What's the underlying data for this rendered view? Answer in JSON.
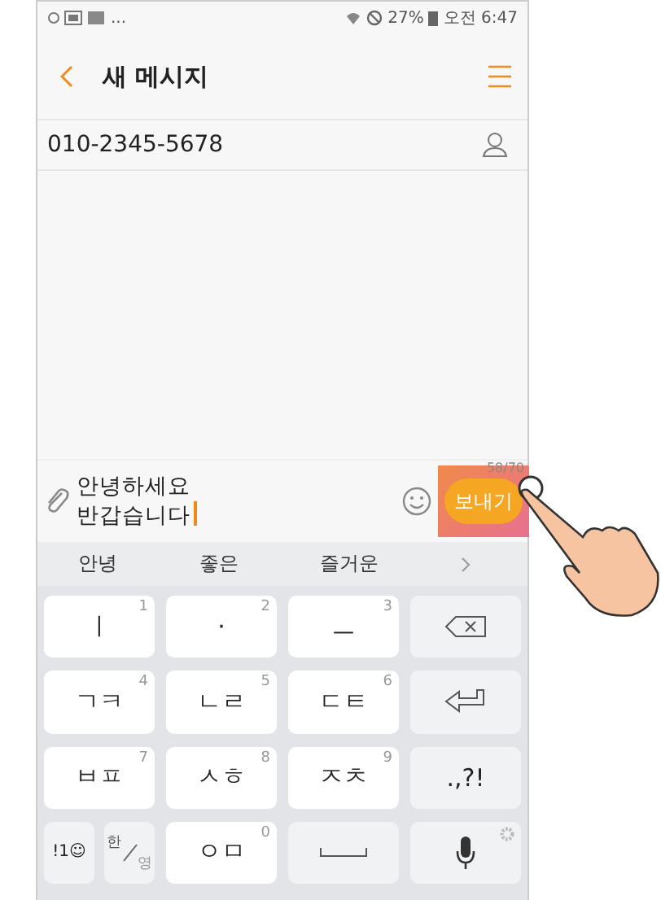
{
  "status_bar": {
    "overflow": "...",
    "battery": "27%",
    "time": "오전 6:47"
  },
  "header": {
    "title": "새 메시지"
  },
  "recipient": {
    "value": "010-2345-5678"
  },
  "composer": {
    "lines": [
      "안녕하세요",
      "반갑습니다"
    ],
    "counter": "58/70",
    "send": "보내기"
  },
  "suggestions": [
    "안녕",
    "좋은",
    "즐거운"
  ],
  "keyboard": [
    [
      {
        "kind": "char",
        "label": "ㅣ",
        "digit": "1"
      },
      {
        "kind": "char",
        "label": "·",
        "digit": "2"
      },
      {
        "kind": "char",
        "label": "ㅡ",
        "digit": "3"
      },
      {
        "kind": "backspace"
      }
    ],
    [
      {
        "kind": "char",
        "label": "ㄱㅋ",
        "digit": "4"
      },
      {
        "kind": "char",
        "label": "ㄴㄹ",
        "digit": "5"
      },
      {
        "kind": "char",
        "label": "ㄷㅌ",
        "digit": "6"
      },
      {
        "kind": "enter"
      }
    ],
    [
      {
        "kind": "char",
        "label": "ㅂㅍ",
        "digit": "7"
      },
      {
        "kind": "char",
        "label": "ㅅㅎ",
        "digit": "8"
      },
      {
        "kind": "char",
        "label": "ㅈㅊ",
        "digit": "9"
      },
      {
        "kind": "fn",
        "label": ".,?!"
      }
    ],
    [
      {
        "kind": "split",
        "symbols": "!1☺",
        "top": "한",
        "bottom": "영"
      },
      {
        "kind": "char",
        "label": "ㅇㅁ",
        "digit": "0"
      },
      {
        "kind": "space"
      },
      {
        "kind": "mic"
      }
    ]
  ]
}
